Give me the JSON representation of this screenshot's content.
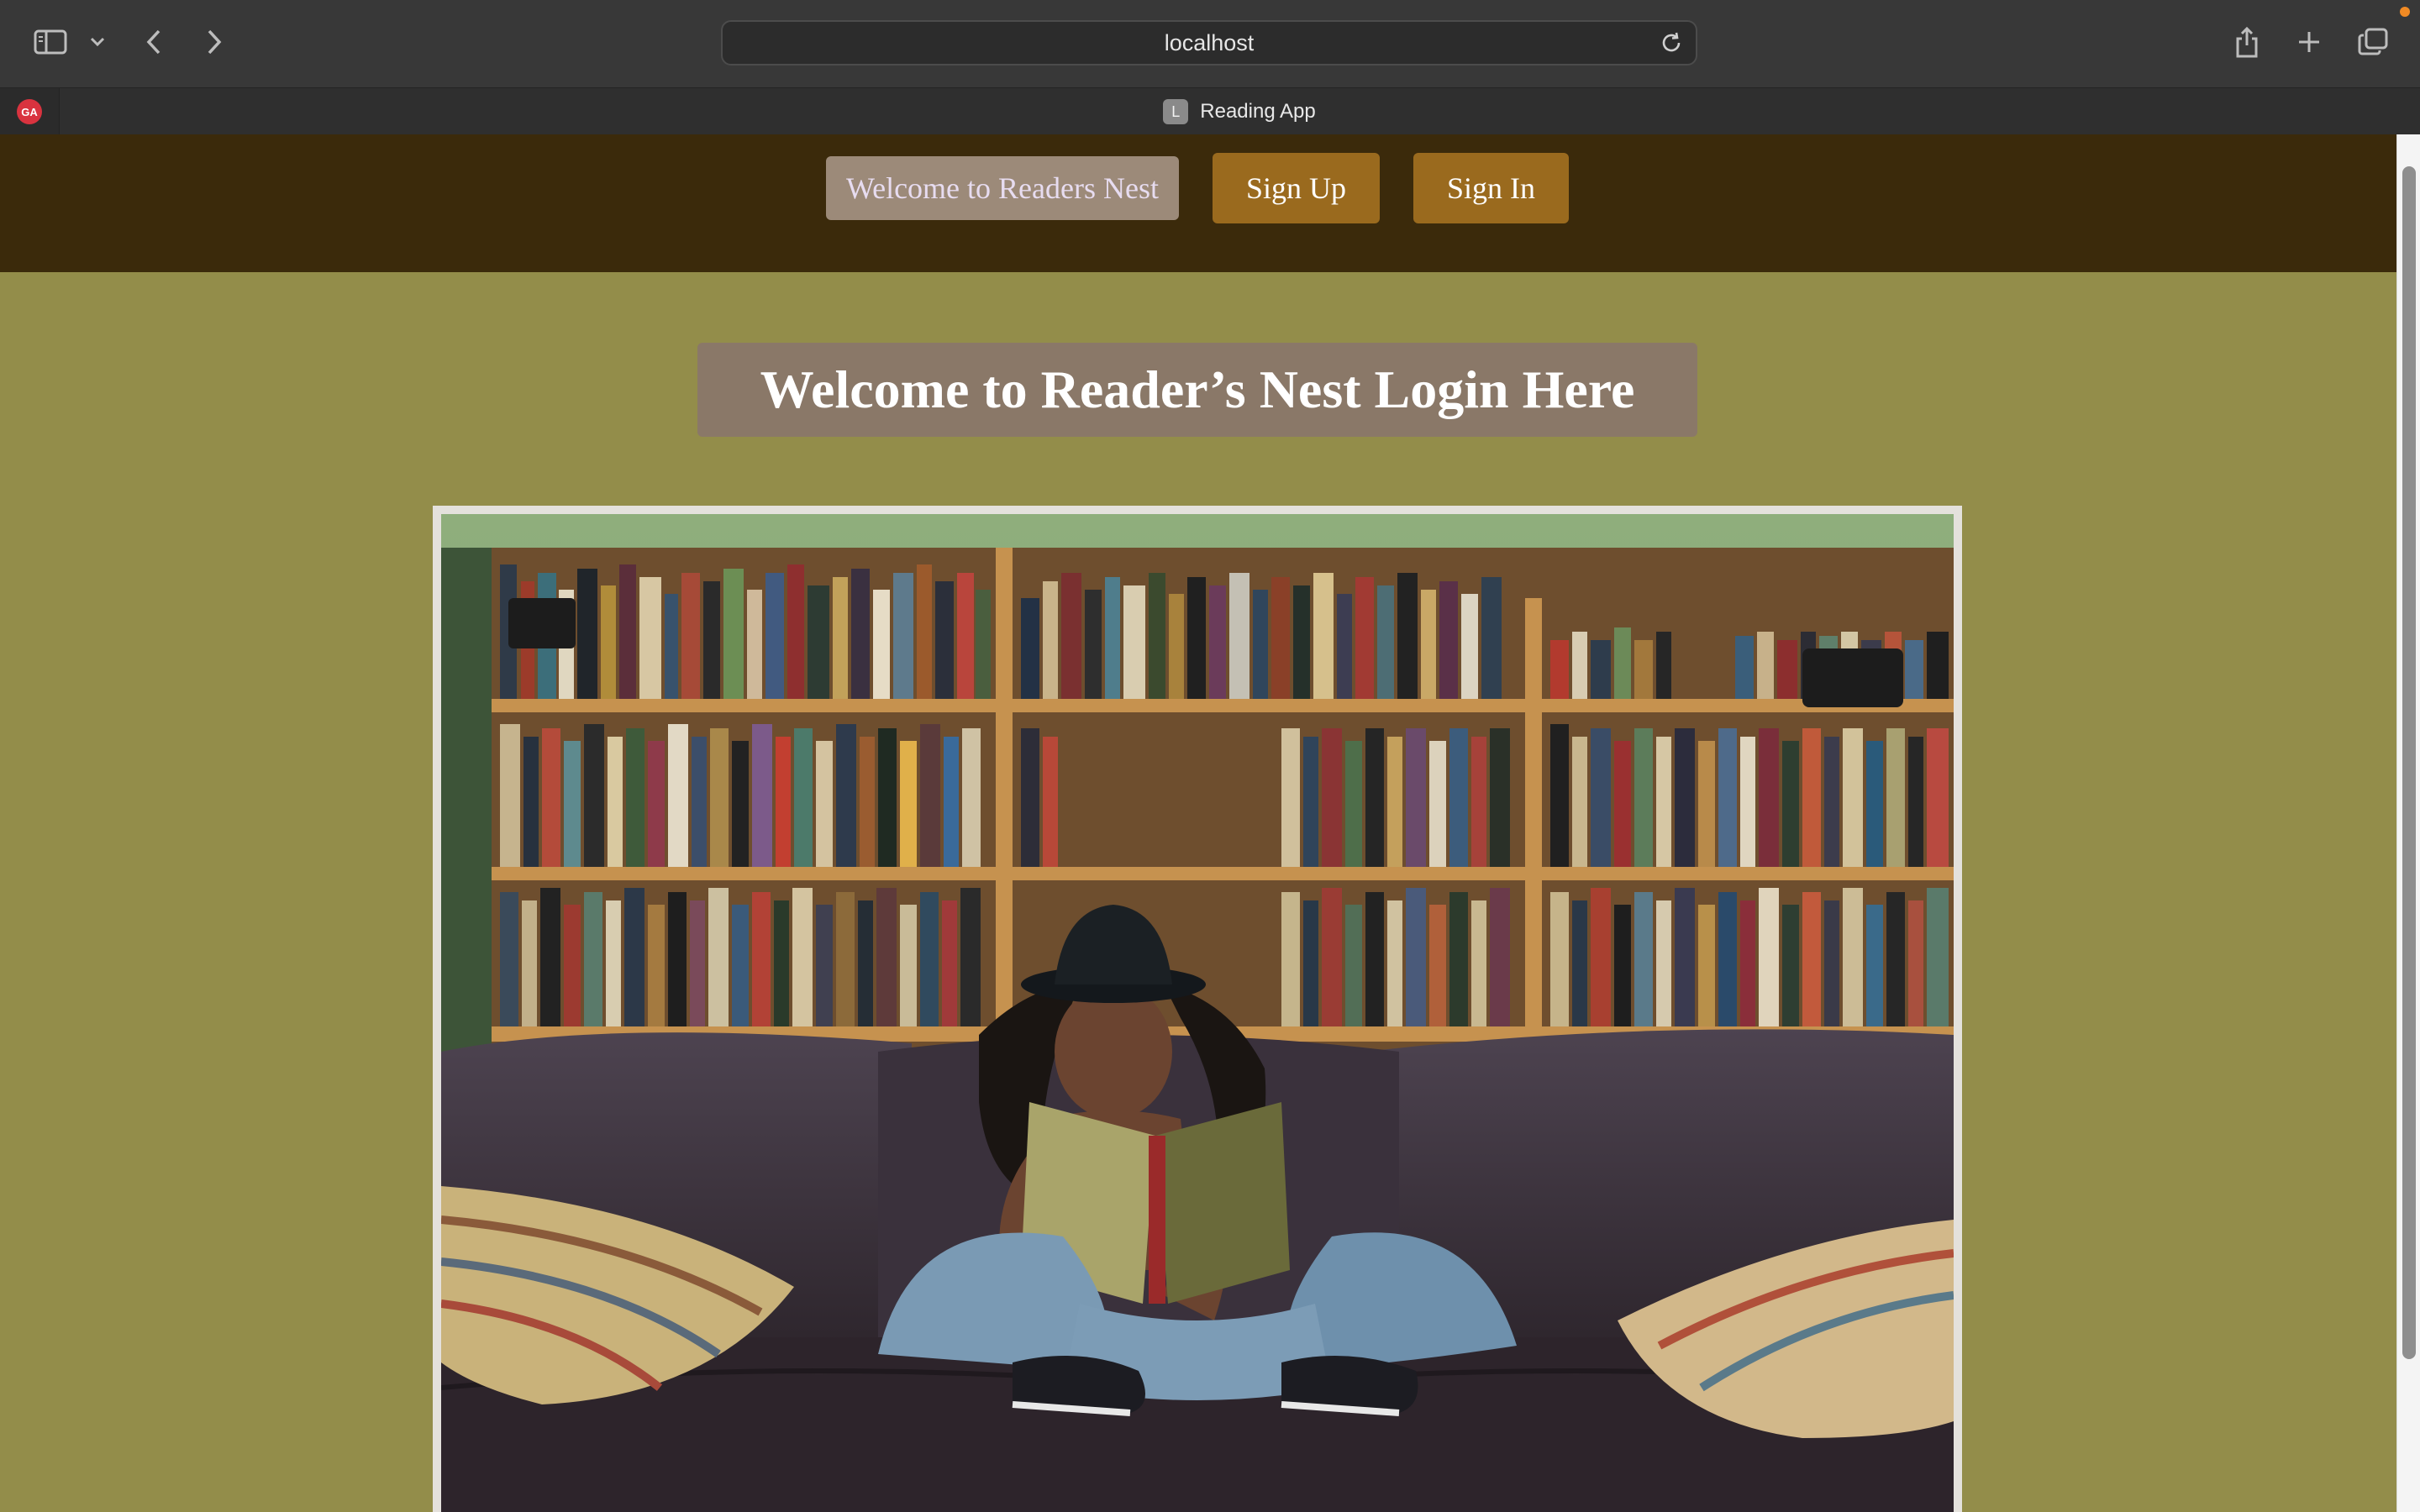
{
  "browser": {
    "url": "localhost",
    "tab_title": "Reading App",
    "tab_favicon_letter": "L",
    "pinned_tab_label": "GA"
  },
  "header": {
    "brand_button": "Welcome to Readers Nest",
    "signup_button": "Sign Up",
    "signin_button": "Sign In"
  },
  "main": {
    "title": "Welcome to Reader’s Nest Login Here"
  },
  "colors": {
    "header_bg": "#3b2a0b",
    "page_bg": "#938d4a",
    "button_bg": "#9a6a1e",
    "title_bg": "#8a7868"
  }
}
